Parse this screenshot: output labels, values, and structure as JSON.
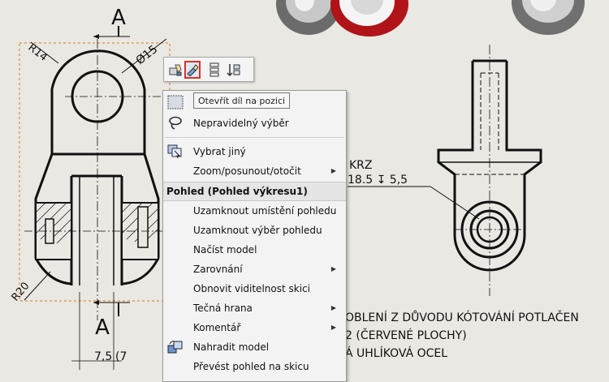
{
  "drawing": {
    "section_mark_top": "A",
    "section_mark_bottom": "A",
    "dim_r14": "R14",
    "dim_dia15": "Ø15",
    "dim_r20": "R20",
    "dim_bottom": "7,5",
    "dim_bottom_tol": "(7",
    "hole_note_line1": "KRZ",
    "hole_note_line2": "18.5 ↧ 5,5",
    "note_line1": "OBLENÍ Z DŮVODU KÓTOVÁNÍ POTLAČEN",
    "note_line2": "2 (ČERVENÉ PLOCHY)",
    "note_line3": "Á UHLÍKOVÁ OCEL"
  },
  "toolbar": {
    "buttons": [
      {
        "icon": "hand-part-icon"
      },
      {
        "icon": "open-part-icon",
        "active": true
      },
      {
        "icon": "component-tree-icon"
      },
      {
        "icon": "sort-arrows-icon"
      }
    ]
  },
  "tooltip": {
    "text": "Otevřít díl na pozici"
  },
  "menu": {
    "items": [
      {
        "label": "",
        "icon": "select-box-icon"
      },
      {
        "label": "Nepravidelný výběr",
        "icon": "lasso-icon"
      },
      {
        "label": "Vybrat jiný",
        "icon": "select-other-icon"
      },
      {
        "label": "Zoom/posunout/otočit",
        "submenu": true
      },
      {
        "label": "Uzamknout umístění pohledu"
      },
      {
        "label": "Uzamknout výběr pohledu"
      },
      {
        "label": "Načíst model"
      },
      {
        "label": "Zarovnání",
        "submenu": true
      },
      {
        "label": "Obnovit viditelnost skici"
      },
      {
        "label": "Tečná hrana",
        "submenu": true
      },
      {
        "label": "Komentář",
        "submenu": true
      },
      {
        "label": "Nahradit model",
        "icon": "replace-model-icon"
      },
      {
        "label": "Převést pohled na skicu"
      }
    ],
    "section_header": "Pohled (Pohled výkresu1)"
  }
}
